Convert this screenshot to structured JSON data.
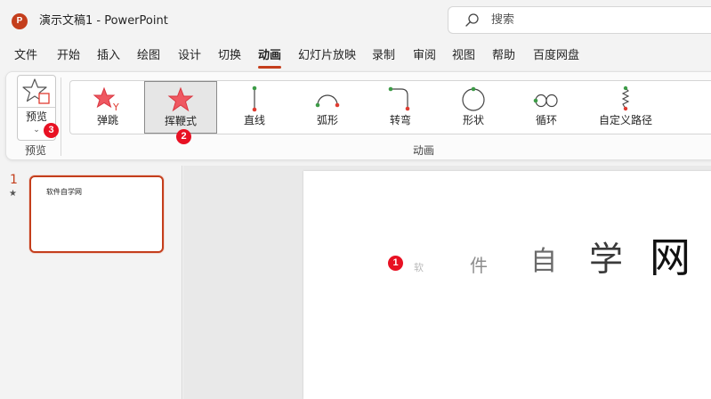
{
  "app": {
    "logo_letter": "P",
    "title": "演示文稿1  -  PowerPoint",
    "accent_color": "#c43e1c"
  },
  "search": {
    "placeholder": "搜索",
    "icon": "search-icon"
  },
  "tabs": [
    {
      "label": "文件"
    },
    {
      "label": "开始"
    },
    {
      "label": "插入"
    },
    {
      "label": "绘图"
    },
    {
      "label": "设计"
    },
    {
      "label": "切换"
    },
    {
      "label": "动画",
      "active": true
    },
    {
      "label": "幻灯片放映"
    },
    {
      "label": "录制"
    },
    {
      "label": "审阅"
    },
    {
      "label": "视图"
    },
    {
      "label": "帮助"
    },
    {
      "label": "百度网盘"
    }
  ],
  "ribbon": {
    "preview": {
      "button_label": "预览",
      "group_label": "预览",
      "icon": "star-preview-icon"
    },
    "animation_group_label": "动画",
    "effects": [
      {
        "label": "弹跳",
        "icon": "bounce-star-icon"
      },
      {
        "label": "挥鞭式",
        "icon": "whip-star-icon",
        "selected": true
      },
      {
        "label": "直线",
        "icon": "line-path-icon"
      },
      {
        "label": "弧形",
        "icon": "arc-path-icon"
      },
      {
        "label": "转弯",
        "icon": "turn-path-icon"
      },
      {
        "label": "形状",
        "icon": "shape-path-icon"
      },
      {
        "label": "循环",
        "icon": "loop-path-icon"
      },
      {
        "label": "自定义路径",
        "icon": "custom-path-icon"
      }
    ]
  },
  "badges": [
    "1",
    "2",
    "3"
  ],
  "thumbnails": [
    {
      "number": "1",
      "star": "★",
      "text": "软件自学网"
    }
  ],
  "slide": {
    "chars": [
      "软",
      "件",
      "自",
      "学",
      "网"
    ],
    "char_colors": [
      "#b9b9b9",
      "#8c8c8c",
      "#6a6a6a",
      "#3a3a3a",
      "#111111"
    ]
  }
}
